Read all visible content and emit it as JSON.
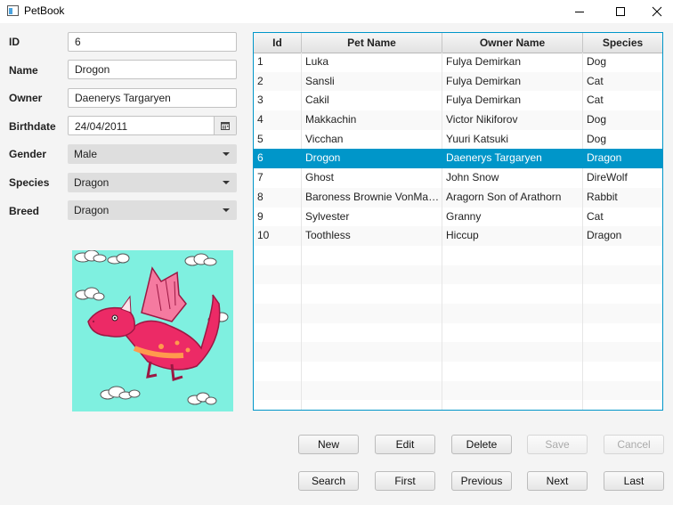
{
  "window": {
    "title": "PetBook"
  },
  "form": {
    "id_label": "ID",
    "id_value": "6",
    "name_label": "Name",
    "name_value": "Drogon",
    "owner_label": "Owner",
    "owner_value": "Daenerys Targaryen",
    "birthdate_label": "Birthdate",
    "birthdate_value": "24/04/2011",
    "gender_label": "Gender",
    "gender_value": "Male",
    "species_label": "Species",
    "species_value": "Dragon",
    "breed_label": "Breed",
    "breed_value": "Dragon"
  },
  "table": {
    "columns": [
      "Id",
      "Pet Name",
      "Owner Name",
      "Species"
    ],
    "selected_index": 5,
    "rows": [
      [
        "1",
        "Luka",
        "Fulya Demirkan",
        "Dog"
      ],
      [
        "2",
        "Sansli",
        "Fulya Demirkan",
        "Cat"
      ],
      [
        "3",
        "Cakil",
        "Fulya Demirkan",
        "Cat"
      ],
      [
        "4",
        "Makkachin",
        "Victor Nikiforov",
        "Dog"
      ],
      [
        "5",
        "Vicchan",
        "Yuuri Katsuki",
        "Dog"
      ],
      [
        "6",
        "Drogon",
        "Daenerys Targaryen",
        "Dragon"
      ],
      [
        "7",
        "Ghost",
        "John Snow",
        "DireWolf"
      ],
      [
        "8",
        "Baroness Brownie VonMarsh…",
        "Aragorn Son of Arathorn",
        "Rabbit"
      ],
      [
        "9",
        "Sylvester",
        "Granny",
        "Cat"
      ],
      [
        "10",
        "Toothless",
        "Hiccup",
        "Dragon"
      ]
    ],
    "empty_rows": 9
  },
  "buttons": {
    "new": "New",
    "edit": "Edit",
    "delete": "Delete",
    "save": "Save",
    "cancel": "Cancel",
    "search": "Search",
    "first": "First",
    "previous": "Previous",
    "next": "Next",
    "last": "Last"
  },
  "colors": {
    "accent": "#0096c9",
    "image_bg": "#7ff0e0",
    "dragon_body": "#ec2a66"
  }
}
